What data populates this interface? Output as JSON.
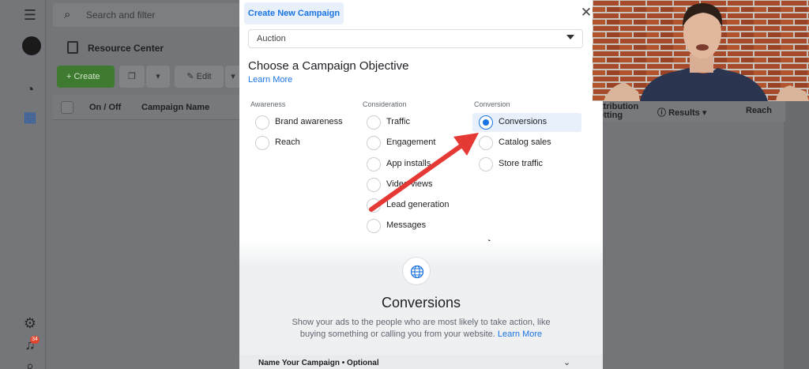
{
  "search": {
    "placeholder": "Search and filter"
  },
  "resource_center": {
    "label": "Resource Center"
  },
  "toolbar": {
    "create_label": "Create",
    "edit_label": "Edit"
  },
  "table": {
    "columns": [
      "On / Off",
      "Campaign Name"
    ],
    "right_columns": [
      "Attribution setting",
      "Results",
      "Reach"
    ]
  },
  "notifications": {
    "count": "34"
  },
  "modal": {
    "tab": "Create New Campaign",
    "buying_type": "Auction",
    "objective_title": "Choose a Campaign Objective",
    "learn_more": "Learn More",
    "columns": [
      {
        "heading": "Awareness",
        "options": [
          "Brand awareness",
          "Reach"
        ]
      },
      {
        "heading": "Consideration",
        "options": [
          "Traffic",
          "Engagement",
          "App installs",
          "Video views",
          "Lead generation",
          "Messages"
        ]
      },
      {
        "heading": "Conversion",
        "options": [
          "Conversions",
          "Catalog sales",
          "Store traffic"
        ]
      }
    ],
    "selected": "Conversions",
    "detail": {
      "title": "Conversions",
      "description": "Show your ads to the people who are most likely to take action, like buying something or calling you from your website.",
      "learn_more": "Learn More"
    },
    "name_section": "Name Your Campaign • Optional"
  },
  "colors": {
    "accent": "#1b74e4",
    "arrow": "#e53935",
    "create_green": "#42b72a"
  }
}
